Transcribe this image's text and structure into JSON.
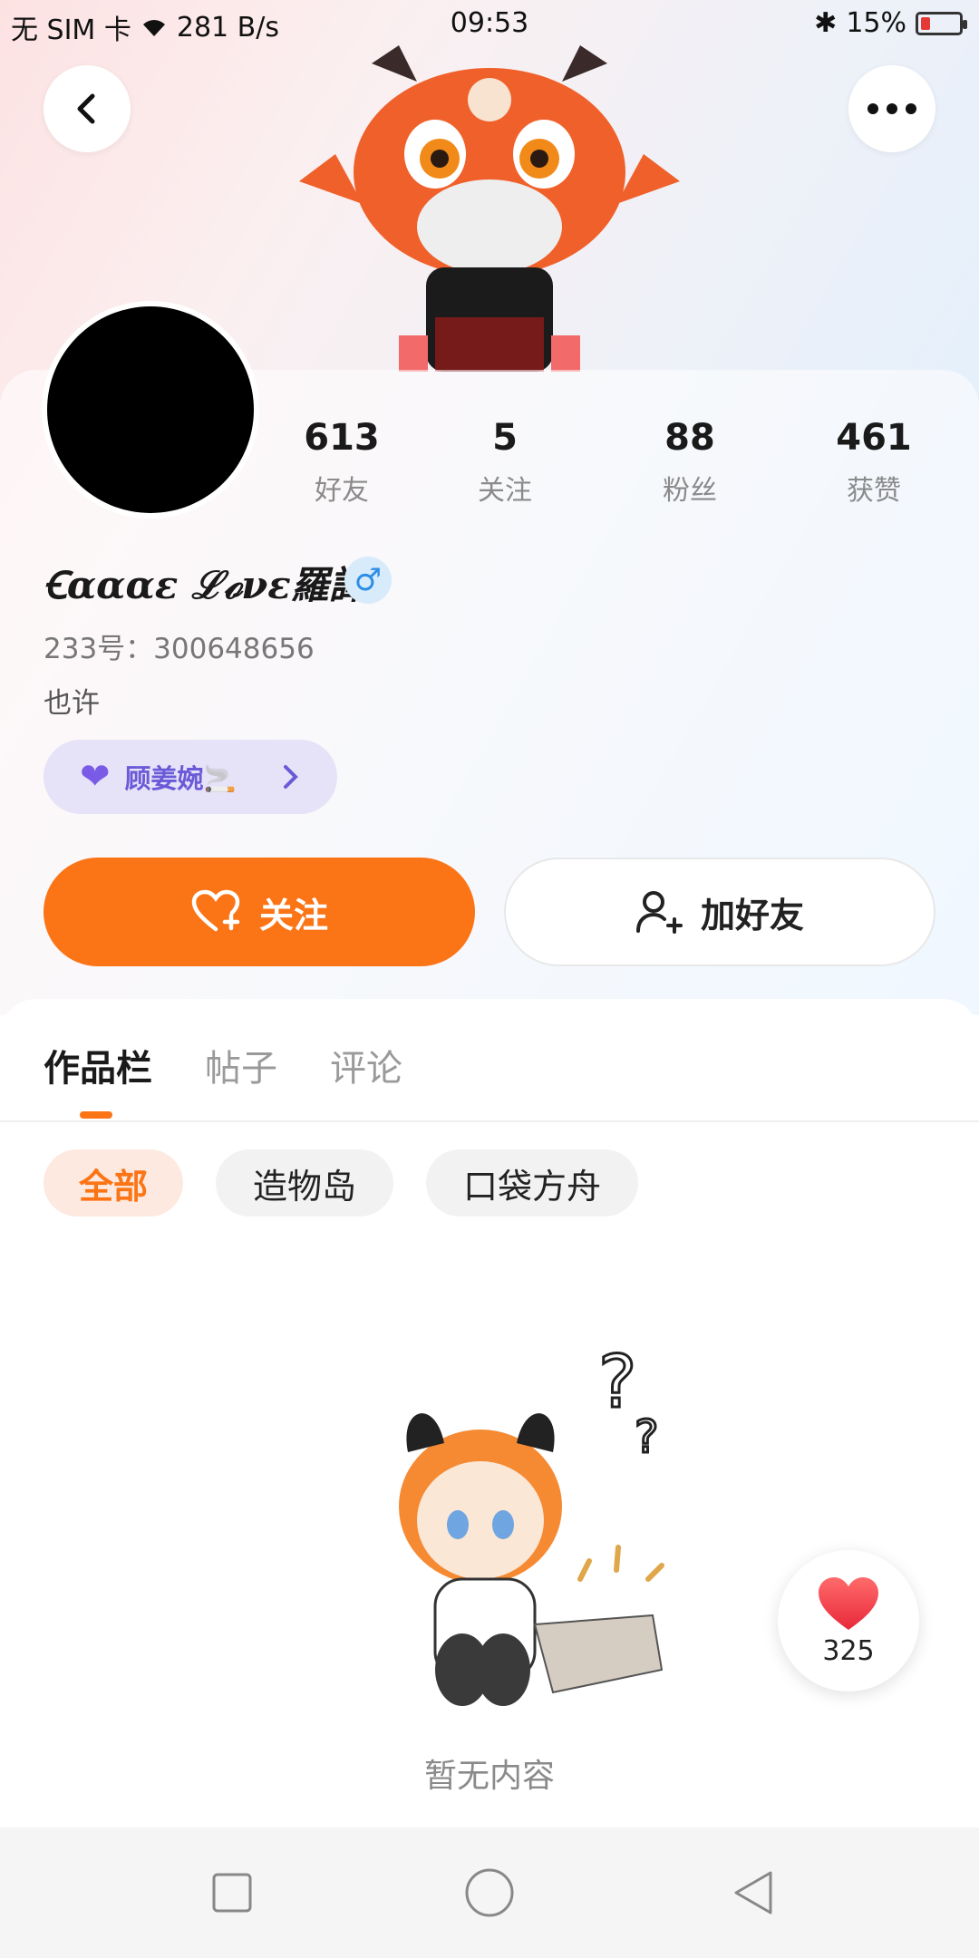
{
  "status_bar": {
    "carrier": "无 SIM 卡",
    "speed": "281 B/s",
    "time": "09:53",
    "battery": "15%"
  },
  "profile": {
    "stats": [
      {
        "value": "613",
        "label": "好友"
      },
      {
        "value": "5",
        "label": "关注"
      },
      {
        "value": "88",
        "label": "粉丝"
      },
      {
        "value": "461",
        "label": "获赞"
      }
    ],
    "username": "Ꞓɑɑɑɛ ℒℴνɛ羅譯",
    "gender_symbol": "♂",
    "uid": "233号：300648656",
    "bio": "也许",
    "couple_name": "顾姜婉🚬"
  },
  "actions": {
    "follow_label": "关注",
    "add_friend_label": "加好友"
  },
  "tabs": [
    "作品栏",
    "帖子",
    "评论"
  ],
  "chips": [
    "全部",
    "造物岛",
    "口袋方舟"
  ],
  "empty_text": "暂无内容",
  "like_count": "325",
  "colors": {
    "accent": "#fb7416",
    "couple_bg": "#e6e2f7",
    "couple_text": "#6a5ad8",
    "gender": "#2d8ee6"
  }
}
